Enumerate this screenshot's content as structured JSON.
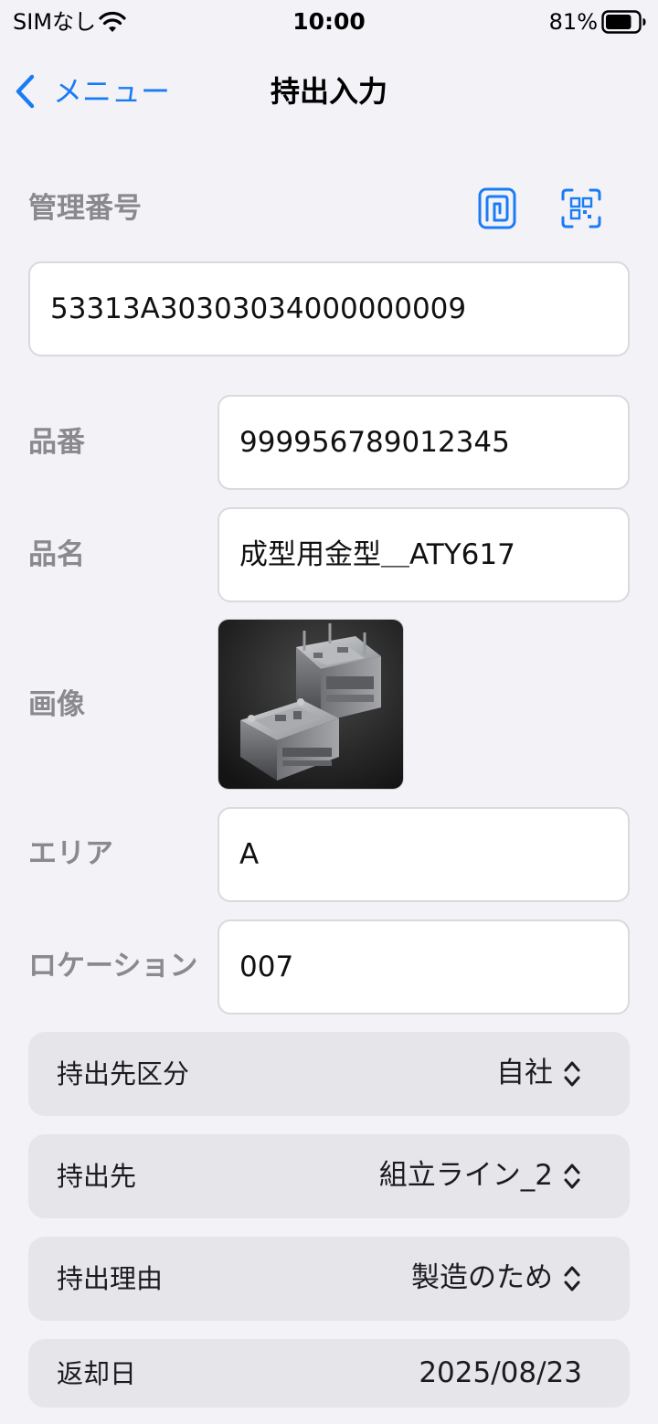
{
  "status_bar": {
    "carrier": "SIMなし",
    "time": "10:00",
    "battery_percent": "81%",
    "battery_level": 0.81
  },
  "nav": {
    "back_label": "メニュー",
    "title": "持出入力"
  },
  "form": {
    "management_number": {
      "label": "管理番号",
      "value": "53313A30303034000000009"
    },
    "part_number": {
      "label": "品番",
      "value": "999956789012345"
    },
    "part_name": {
      "label": "品名",
      "value": "成型用金型＿ATY617"
    },
    "image": {
      "label": "画像"
    },
    "area": {
      "label": "エリア",
      "value": "A"
    },
    "location": {
      "label": "ロケーション",
      "value": "007"
    }
  },
  "pickers": [
    {
      "label": "持出先区分",
      "value": "自社"
    },
    {
      "label": "持出先",
      "value": "組立ライン_2"
    },
    {
      "label": "持出理由",
      "value": "製造のため"
    }
  ],
  "return_date": {
    "label": "返却日",
    "value": "2025/08/23"
  },
  "icons": {
    "nfc": "nfc-scan-icon",
    "qr": "qr-scan-icon",
    "back": "chevron-left-icon",
    "updown": "chevron-updown-icon"
  },
  "colors": {
    "accent": "#1a7cf5",
    "background": "#f2f2f7",
    "label": "#8a8a8e",
    "picker_bg": "#e5e5ea"
  }
}
